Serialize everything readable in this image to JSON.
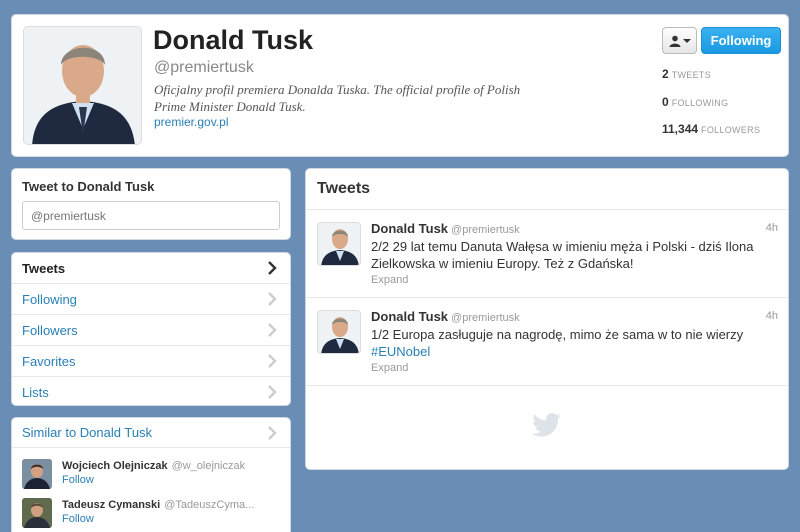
{
  "profile": {
    "name": "Donald Tusk",
    "handle": "@premiertusk",
    "bio": "Oficjalny profil premiera Donalda Tuska. The official profile of Polish Prime Minister Donald Tusk.",
    "url": "premier.gov.pl",
    "follow_label": "Following",
    "stats": [
      {
        "value": "2",
        "label": "TWEETS"
      },
      {
        "value": "0",
        "label": "FOLLOWING"
      },
      {
        "value": "11,344",
        "label": "FOLLOWERS"
      }
    ]
  },
  "tweet_to": {
    "title": "Tweet to Donald Tusk",
    "placeholder": "@premiertusk"
  },
  "nav": {
    "items": [
      {
        "label": "Tweets"
      },
      {
        "label": "Following"
      },
      {
        "label": "Followers"
      },
      {
        "label": "Favorites"
      },
      {
        "label": "Lists"
      }
    ]
  },
  "similar": {
    "title": "Similar to Donald Tusk",
    "users": [
      {
        "name": "Wojciech Olejniczak",
        "handle": "@w_olejniczak",
        "follow": "Follow"
      },
      {
        "name": "Tadeusz Cymanski",
        "handle": "@TadeuszCyma...",
        "follow": "Follow"
      }
    ]
  },
  "tweets": {
    "title": "Tweets",
    "items": [
      {
        "name": "Donald Tusk",
        "handle": "@premiertusk",
        "time": "4h",
        "text": "2/2 29 lat temu Danuta Wałęsa w imieniu męża i Polski - dziś Ilona Zielkowska w imieniu Europy. Też z Gdańska!",
        "expand": "Expand"
      },
      {
        "name": "Donald Tusk",
        "handle": "@premiertusk",
        "time": "4h",
        "text": "1/2 Europa zasługuje na nagrodę, mimo że sama w to nie wierzy ",
        "hashtag": "#EUNobel",
        "expand": "Expand"
      }
    ]
  },
  "colors": {
    "background": "#6a8db5",
    "link": "#2a7fb5",
    "follow_button": "#1a9ae3"
  }
}
